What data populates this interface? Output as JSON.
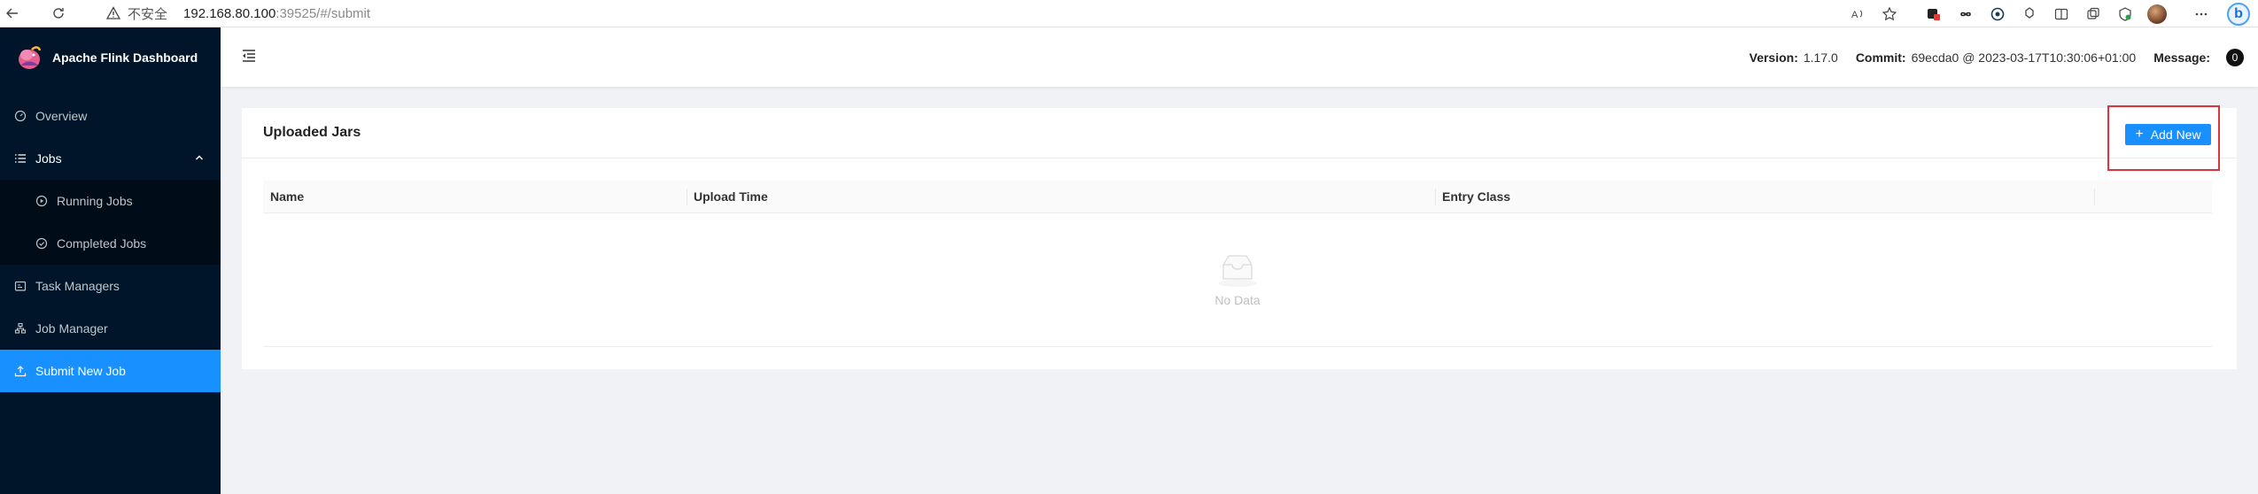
{
  "browser": {
    "insecure_label": "不安全",
    "url_host": "192.168.80.100",
    "url_path": ":39525/#/submit",
    "icons": [
      "back-icon",
      "refresh-icon",
      "warning-icon",
      "read-aloud-icon",
      "favorite-icon",
      "extension-icon",
      "infinity-icon",
      "shield-icon",
      "sync-icon",
      "split-screen-icon",
      "collections-icon",
      "browser-essentials-icon",
      "profile-avatar",
      "more-icon",
      "bing-icon"
    ]
  },
  "sidebar": {
    "logo_text": "Apache Flink Dashboard",
    "items": [
      {
        "label": "Overview",
        "icon": "dashboard-icon"
      },
      {
        "label": "Jobs",
        "icon": "list-icon",
        "expanded": true
      },
      {
        "label": "Running Jobs",
        "icon": "play-circle-icon"
      },
      {
        "label": "Completed Jobs",
        "icon": "check-circle-icon"
      },
      {
        "label": "Task Managers",
        "icon": "schedule-icon"
      },
      {
        "label": "Job Manager",
        "icon": "cluster-icon"
      },
      {
        "label": "Submit New Job",
        "icon": "upload-icon",
        "active": true
      }
    ]
  },
  "header": {
    "version_label": "Version:",
    "version_value": "1.17.0",
    "commit_label": "Commit:",
    "commit_value": "69ecda0 @ 2023-03-17T10:30:06+01:00",
    "message_label": "Message:",
    "message_count": "0"
  },
  "main": {
    "card_title": "Uploaded Jars",
    "add_button": "Add New",
    "columns": [
      "Name",
      "Upload Time",
      "Entry Class"
    ],
    "empty_text": "No Data"
  },
  "colors": {
    "sidebar_bg": "#001529",
    "accent": "#1890ff",
    "highlight_outline": "#d9363e"
  }
}
